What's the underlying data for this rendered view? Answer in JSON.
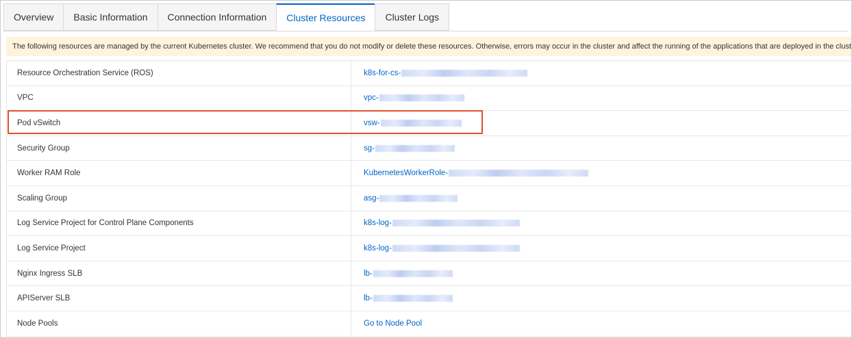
{
  "tabs": [
    {
      "label": "Overview",
      "active": false
    },
    {
      "label": "Basic Information",
      "active": false
    },
    {
      "label": "Connection Information",
      "active": false
    },
    {
      "label": "Cluster Resources",
      "active": true
    },
    {
      "label": "Cluster Logs",
      "active": false
    }
  ],
  "notice": "The following resources are managed by the current Kubernetes cluster. We recommend that you do not modify or delete these resources. Otherwise, errors may occur in the cluster and affect the running of the applications that are deployed in the cluster.",
  "resources": [
    {
      "label": "Resource Orchestration Service (ROS)",
      "value": "k8s-for-cs-"
    },
    {
      "label": "VPC",
      "value": "vpc-"
    },
    {
      "label": "Pod vSwitch",
      "value": "vsw-"
    },
    {
      "label": "Security Group",
      "value": "sg-"
    },
    {
      "label": "Worker RAM Role",
      "value": "KubernetesWorkerRole-"
    },
    {
      "label": "Scaling Group",
      "value": "asg-"
    },
    {
      "label": "Log Service Project for Control Plane Components",
      "value": "k8s-log-"
    },
    {
      "label": "Log Service Project",
      "value": "k8s-log-"
    },
    {
      "label": "Nginx Ingress SLB",
      "value": "lb-"
    },
    {
      "label": "APIServer SLB",
      "value": "lb-"
    },
    {
      "label": "Node Pools",
      "value": "Go to Node Pool"
    }
  ],
  "colors": {
    "accent": "#0064c8",
    "notice_bg": "#fff3dc",
    "highlight": "#e0502a"
  }
}
